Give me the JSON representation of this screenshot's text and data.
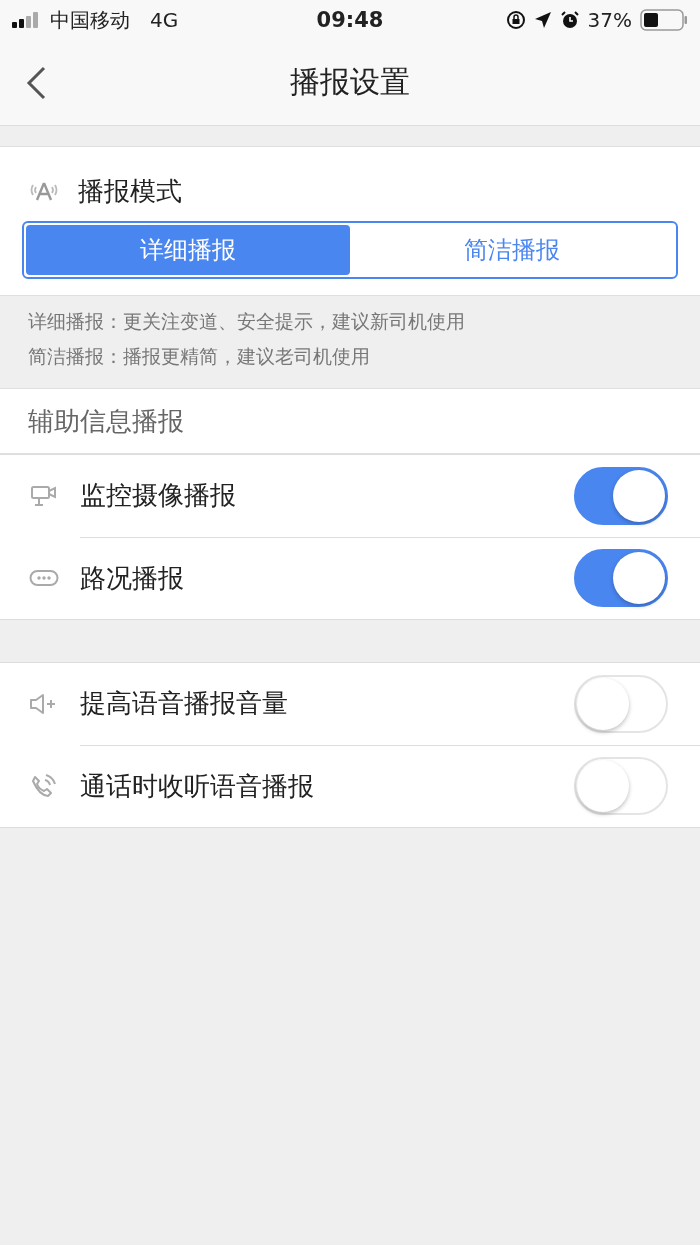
{
  "status_bar": {
    "carrier": "中国移动",
    "network": "4G",
    "time": "09:48",
    "battery": "37%"
  },
  "nav": {
    "title": "播报设置"
  },
  "mode": {
    "title": "播报模式",
    "options": [
      {
        "label": "详细播报",
        "selected": true
      },
      {
        "label": "简洁播报",
        "selected": false
      }
    ],
    "notes": [
      "详细播报：更关注变道、安全提示，建议新司机使用",
      "简洁播报：播报更精简，建议老司机使用"
    ]
  },
  "assist": {
    "header": "辅助信息播报",
    "rows": [
      {
        "label": "监控摄像播报",
        "on": true
      },
      {
        "label": "路况播报",
        "on": true
      }
    ]
  },
  "extra": {
    "rows": [
      {
        "label": "提高语音播报音量",
        "on": false
      },
      {
        "label": "通话时收听语音播报",
        "on": false
      }
    ]
  }
}
